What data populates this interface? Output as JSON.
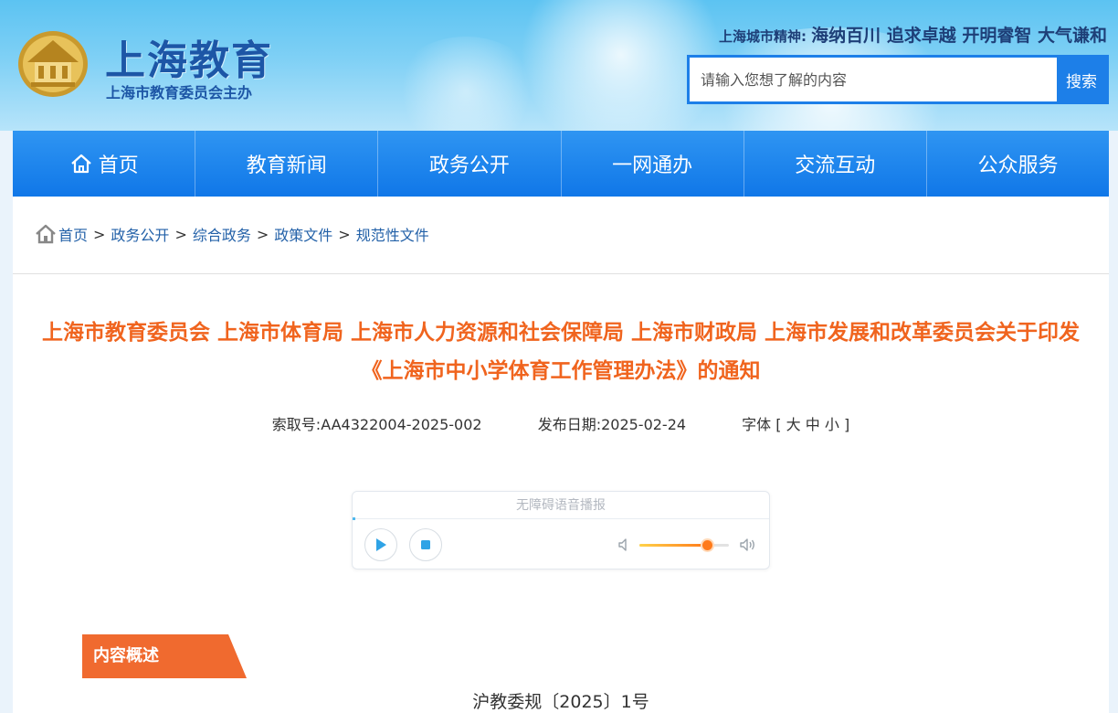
{
  "header": {
    "logo_title": "上海教育",
    "logo_subtitle": "上海市教育委员会主办",
    "slogan_label": "上海城市精神:",
    "slogan_text": "海纳百川 追求卓越 开明睿智 大气谦和",
    "search_placeholder": "请输入您想了解的内容",
    "search_button": "搜索"
  },
  "nav": {
    "items": [
      {
        "label": "首页",
        "icon": "home-icon"
      },
      {
        "label": "教育新闻"
      },
      {
        "label": "政务公开"
      },
      {
        "label": "一网通办"
      },
      {
        "label": "交流互动"
      },
      {
        "label": "公众服务"
      }
    ]
  },
  "breadcrumb": {
    "items": [
      "首页",
      "政务公开",
      "综合政务",
      "政策文件",
      "规范性文件"
    ],
    "separator": ">"
  },
  "article": {
    "title": "上海市教育委员会 上海市体育局 上海市人力资源和社会保障局 上海市财政局 上海市发展和改革委员会关于印发《上海市中小学体育工作管理办法》的通知",
    "index_no": "索取号:AA4322004-2025-002",
    "publish_date": "发布日期:2025-02-24",
    "font_size_label": "字体 [",
    "font_large": "大",
    "font_medium": "中",
    "font_small": "小",
    "font_size_end": "]",
    "section_tag": "内容概述",
    "doc_number": "沪教委规〔2025〕1号"
  },
  "player": {
    "title": "无障碍语音播报",
    "volume": 0.75,
    "colors": {
      "accent": "#4fb8ee",
      "volume": "#ff7a1a"
    }
  },
  "colors": {
    "nav_blue": "#1077e8",
    "title_orange": "#f0641e",
    "tag_orange": "#f06a2f",
    "link_blue": "#2361a8"
  }
}
